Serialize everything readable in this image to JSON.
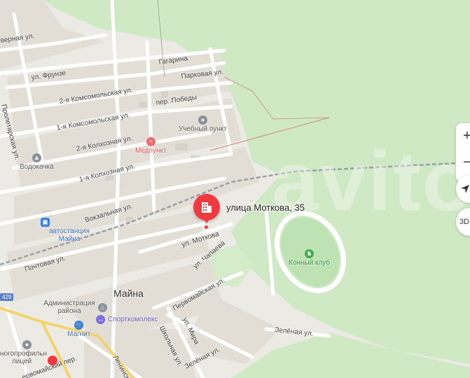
{
  "map": {
    "town": "Майна",
    "selected_address": "улица Моткова, 35",
    "road_number": "429",
    "streets": [
      "верная ул.",
      "Гагарина",
      "ул. Фрунзе",
      "Парковая ул.",
      "2-я Комсомольская ул.",
      "пер. Победы",
      "1-я Комсомольская ул.",
      "Пролетарская ул.",
      "2-я Колхозная ул.",
      "1-я Колхозная ул.",
      "Вокзальная ул.",
      "ул. Моткова",
      "Почтовая ул.",
      "ул. Чапаева",
      "Первомайская ул.",
      "ул. Мира",
      "Школьная ул.",
      "Зелёная ул.",
      "Зелёная ул.",
      "Ленинск",
      "ервомайский пер."
    ],
    "pois": [
      {
        "label": "Учебный пункт",
        "icon": "education-icon",
        "color": "#8a9299"
      },
      {
        "label": "Медпункт",
        "icon": "medical-cross-icon",
        "color": "#f06c6c"
      },
      {
        "label": "Водокачка",
        "icon": "water-tower-icon",
        "color": "#8a9299"
      },
      {
        "label": "автостанция Майна",
        "icon": "bus-station-icon",
        "color": "#3b7ddd"
      },
      {
        "label": "Конный клуб",
        "icon": "horse-icon",
        "color": "#3fae49"
      },
      {
        "label": "Администрация района",
        "icon": "government-icon",
        "color": "#8a9299"
      },
      {
        "label": "Спорткомплекс",
        "icon": "sports-icon",
        "color": "#7a6ee0"
      },
      {
        "label": "Магнит",
        "icon": "shop-icon",
        "color": "#3b7ddd"
      },
      {
        "label": "ногопрофильн лицей",
        "icon": "school-icon",
        "color": "#8a9299"
      }
    ],
    "watermark": "avito"
  },
  "controls": {
    "zoom_in": "+",
    "zoom_out": "−",
    "locate": "locate-arrow-icon",
    "mode_3d": "3D"
  }
}
